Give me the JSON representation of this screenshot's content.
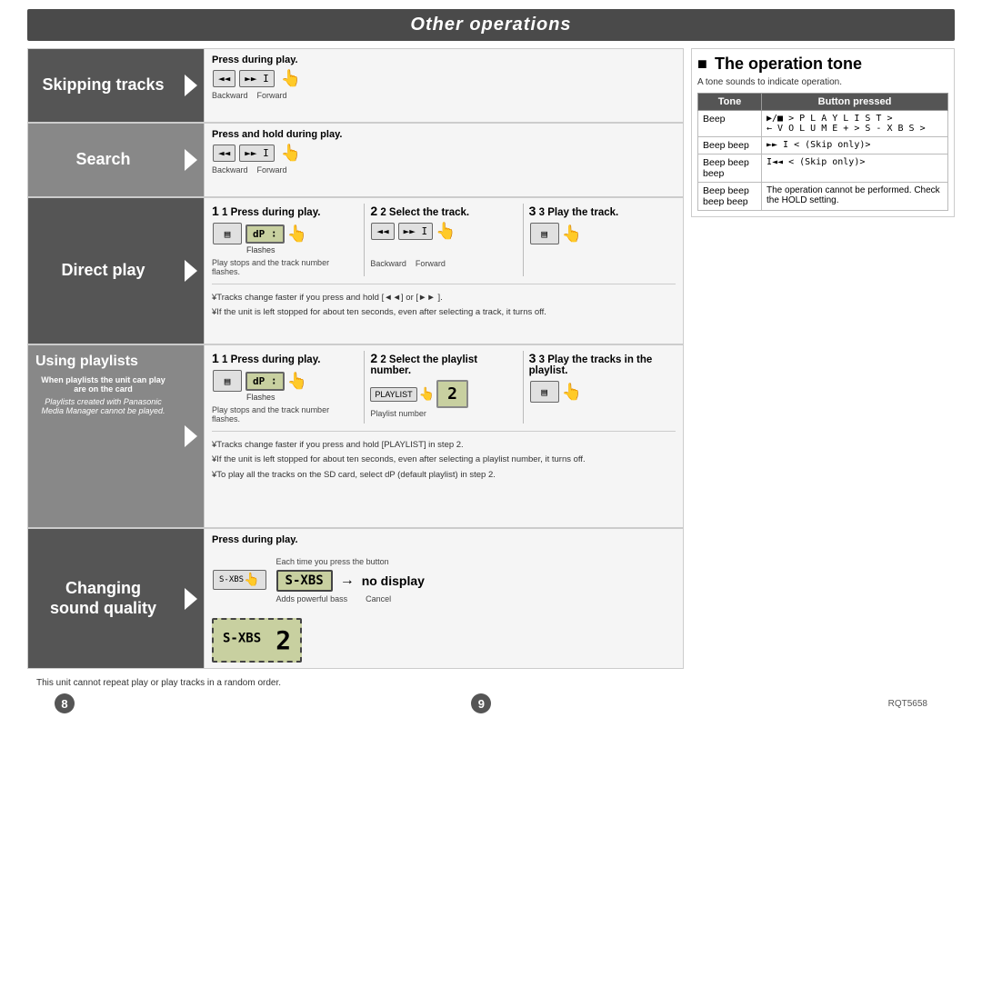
{
  "title": "Other operations",
  "sections": [
    {
      "id": "skipping-tracks",
      "label": "Skipping tracks",
      "steps": {
        "header": "Press during play.",
        "description": "Backward / Forward skip"
      }
    },
    {
      "id": "search",
      "label": "Search",
      "steps": {
        "header": "Press and hold during play.",
        "description": "Backward / Forward search"
      }
    },
    {
      "id": "direct-play",
      "label": "Direct play",
      "step1_header": "1 Press during play.",
      "step2_header": "2 Select the track.",
      "step3_header": "3 Play the track.",
      "flashes": "Flashes",
      "play_stops_note": "Play stops and the track number flashes.",
      "note1": "¥Tracks change faster if you press and hold [◄◄] or [►► ].",
      "note2": "¥If the unit is left stopped for about ten seconds, even after selecting a track, it turns off."
    },
    {
      "id": "using-playlists",
      "label": "Using playlists",
      "when_note": "When playlists the unit can play are on the card",
      "when_note2": "Playlists created with Panasonic Media Manager cannot be played.",
      "step1_header": "1 Press during play.",
      "step2_header": "2 Select the playlist number.",
      "step3_header": "3 Play the tracks in the playlist.",
      "flashes": "Flashes",
      "play_stops_note": "Play stops and the track number flashes.",
      "playlist_number_label": "Playlist number",
      "note1": "¥Tracks change faster if you press and hold [PLAYLIST] in step 2.",
      "note2": "¥If the unit is left stopped for about ten seconds, even after selecting a playlist number, it turns off.",
      "note3": "¥To play all the tracks on the SD card, select  dP  (default playlist) in step 2."
    },
    {
      "id": "changing-sound-quality",
      "label": "Changing\nsound quality",
      "press_label": "Press during play.",
      "each_time": "Each time you press the button",
      "sxbs": "S-XBS",
      "no_display": "no display",
      "adds_bass": "Adds powerful bass",
      "cancel": "Cancel",
      "display_value": "2"
    }
  ],
  "tone_section": {
    "title": "The operation tone",
    "subtitle": "A tone sounds to indicate operation.",
    "col1": "Tone",
    "col2": "Button pressed",
    "rows": [
      {
        "tone": "Beep",
        "button": "▶/■  > P L A Y L I S T >\n← V O L U M E  +  >  S - X B S  >"
      },
      {
        "tone": "Beep beep",
        "button": "►► I < (Skip only)>"
      },
      {
        "tone": "Beep beep beep",
        "button": "I◄◄ < (Skip only)>"
      },
      {
        "tone": "Beep beep beep beep",
        "button": "The operation cannot be performed. Check the HOLD setting."
      }
    ]
  },
  "footer": {
    "note": "This unit cannot repeat play or play tracks in a random order.",
    "page_left": "8",
    "page_right": "9",
    "model": "RQT5658"
  }
}
